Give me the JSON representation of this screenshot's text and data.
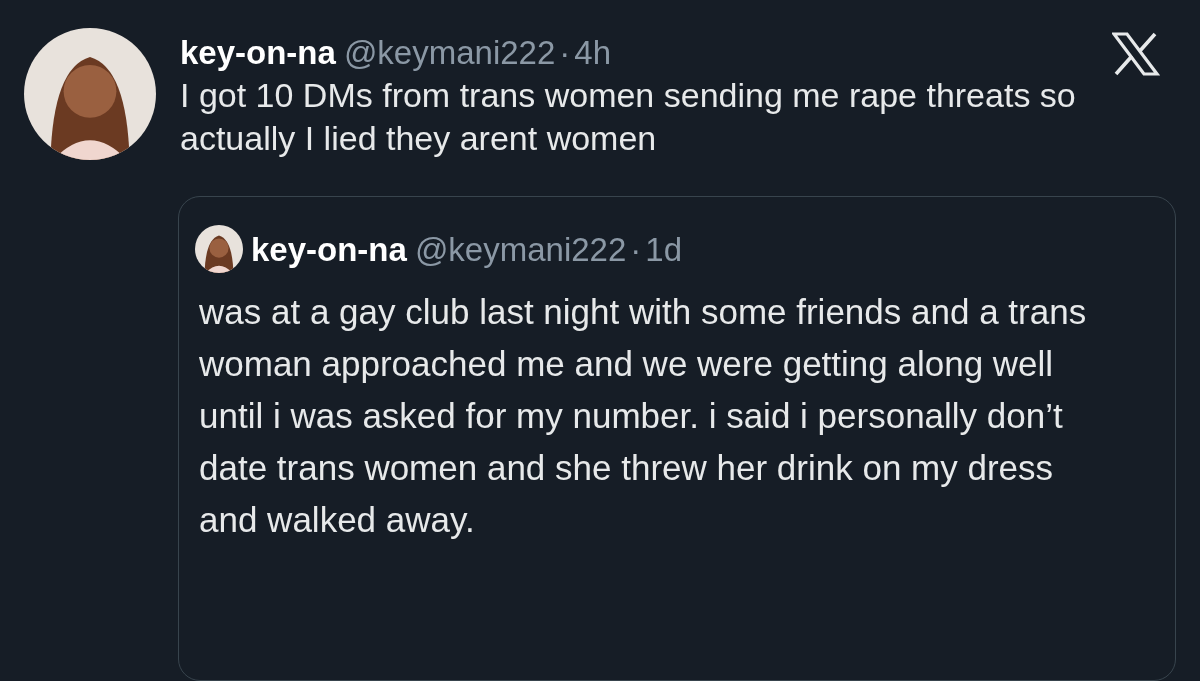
{
  "tweet": {
    "name": "key-on-na",
    "handle": "@keymani222",
    "separator": "·",
    "time": "4h",
    "text": "I got 10 DMs from trans women sending me rape threats so actually I lied they arent women"
  },
  "quoted": {
    "name": "key-on-na",
    "handle": "@keymani222",
    "separator": "·",
    "time": "1d",
    "text": "was at a gay club last night with some friends and a trans woman approached me and we were getting along well until i was asked for my number. i said i personally don’t date trans women and she threw her drink on my dress and walked away."
  }
}
